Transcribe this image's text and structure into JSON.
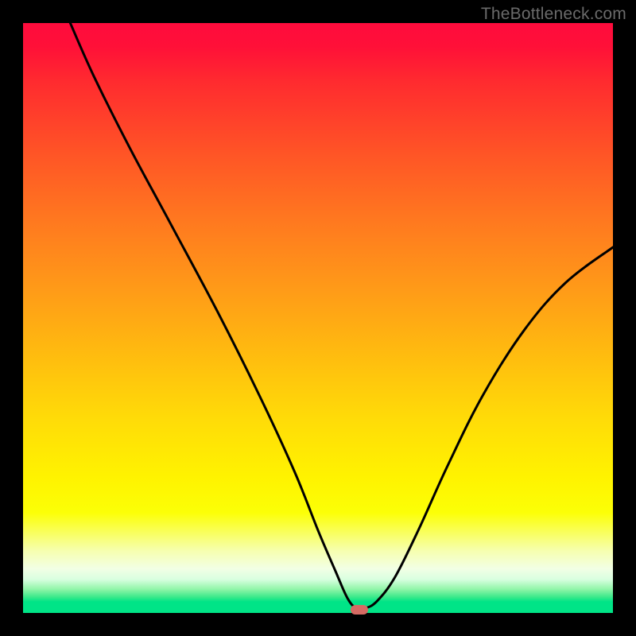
{
  "watermark": "TheBottleneck.com",
  "background": {
    "gradient_stops": [
      {
        "pct": 0,
        "color": "#ff0b3d"
      },
      {
        "pct": 10,
        "color": "#ff2b2f"
      },
      {
        "pct": 34,
        "color": "#ff7a1f"
      },
      {
        "pct": 56,
        "color": "#ffbb0f"
      },
      {
        "pct": 77,
        "color": "#fff300"
      },
      {
        "pct": 92,
        "color": "#f2ffe5"
      },
      {
        "pct": 98,
        "color": "#00e487"
      },
      {
        "pct": 100,
        "color": "#00e487"
      }
    ]
  },
  "chart_data": {
    "type": "line",
    "title": "",
    "xlabel": "",
    "ylabel": "",
    "xlim": [
      0,
      100
    ],
    "ylim": [
      0,
      100
    ],
    "grid": false,
    "legend": false,
    "series": [
      {
        "name": "bottleneck-curve",
        "x": [
          8,
          12,
          18,
          25,
          33,
          40,
          46,
          50,
          53,
          55,
          56.5,
          58,
          60,
          63,
          67,
          72,
          78,
          85,
          92,
          100
        ],
        "y": [
          100,
          91,
          79,
          66,
          51,
          37,
          24,
          14,
          7,
          2.5,
          0.8,
          0.8,
          2,
          6,
          14,
          25,
          37,
          48,
          56,
          62
        ]
      }
    ],
    "marker": {
      "x": 57,
      "y": 0.6,
      "color": "#d66a63"
    }
  }
}
